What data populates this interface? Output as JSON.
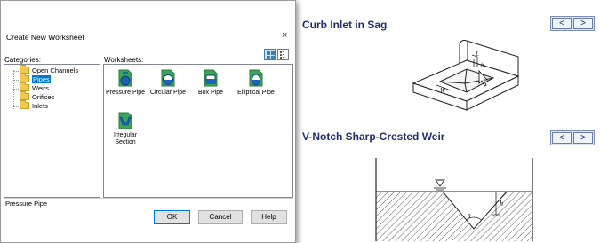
{
  "dialog": {
    "title": "Create New Worksheet",
    "close_symbol": "×",
    "categories_label": "Categories:",
    "worksheets_label": "Worksheets:",
    "categories": [
      {
        "label": "Open Channels",
        "selected": false
      },
      {
        "label": "Pipes",
        "selected": true
      },
      {
        "label": "Weirs",
        "selected": false
      },
      {
        "label": "Orifices",
        "selected": false
      },
      {
        "label": "Inlets",
        "selected": false
      }
    ],
    "worksheets": [
      {
        "label": "Pressure Pipe",
        "icon": "pressure-pipe-icon"
      },
      {
        "label": "Circular Pipe",
        "icon": "circular-pipe-icon"
      },
      {
        "label": "Box Pipe",
        "icon": "box-pipe-icon"
      },
      {
        "label": "Elliptical Pipe",
        "icon": "elliptical-pipe-icon"
      },
      {
        "label": "Irregular Section",
        "icon": "irregular-section-icon"
      }
    ],
    "status_text": "Pressure Pipe",
    "buttons": {
      "ok": "OK",
      "cancel": "Cancel",
      "help": "Help"
    }
  },
  "reference": {
    "sections": [
      {
        "title": "Curb Inlet in Sag",
        "prev": "<",
        "next": ">"
      },
      {
        "title": "V-Notch Sharp-Crested Weir",
        "prev": "<",
        "next": ">"
      }
    ]
  },
  "colors": {
    "selection": "#0078d7",
    "folder": "#f2c94c",
    "heading": "#1f2f6b",
    "icon_blue": "#1f5fbf",
    "icon_green": "#3aa655"
  }
}
